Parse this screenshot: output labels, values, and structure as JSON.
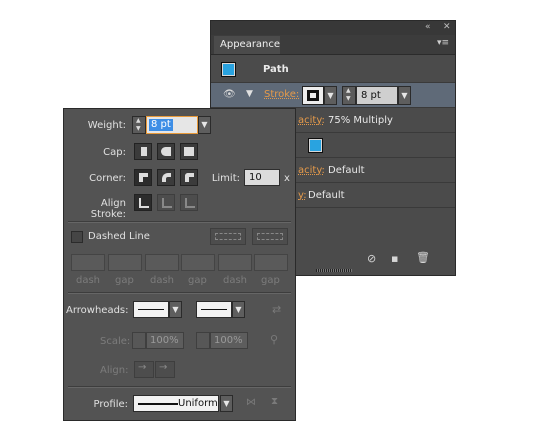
{
  "appearance": {
    "tab": "Appearance",
    "object": "Path",
    "stroke_label": "Stroke:",
    "stroke_weight": "8 pt",
    "row_opacity_1": {
      "label_partial": "acity:",
      "value": "75% Multiply"
    },
    "row_opacity_2": {
      "label_partial": "acity:",
      "value": "Default"
    },
    "row_opacity_3": {
      "label_partial": "y:",
      "value": "Default"
    }
  },
  "stroke_panel": {
    "weight_label": "Weight:",
    "weight_value": "8 pt",
    "cap_label": "Cap:",
    "corner_label": "Corner:",
    "limit_label": "Limit:",
    "limit_value": "10",
    "limit_unit": "x",
    "align_label": "Align Stroke:",
    "dashed_label": "Dashed Line",
    "dash_labels": [
      "dash",
      "gap",
      "dash",
      "gap",
      "dash",
      "gap"
    ],
    "arrowheads_label": "Arrowheads:",
    "scale_label": "Scale:",
    "scale_1": "100%",
    "scale_2": "100%",
    "align_arrow_label": "Align:",
    "profile_label": "Profile:",
    "profile_value": "Uniform"
  },
  "colors": {
    "stroke_swatch": "#29a3e0",
    "accent_orange": "#e59a4a"
  }
}
